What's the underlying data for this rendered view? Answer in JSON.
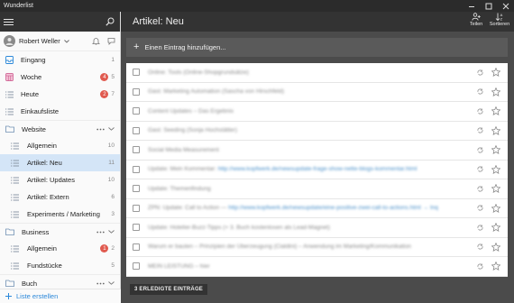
{
  "window": {
    "title": "Wunderlist"
  },
  "user": {
    "name": "Robert Weller"
  },
  "sidebar": {
    "items": [
      {
        "label": "Eingang",
        "count": "1",
        "badge": "",
        "icon": "inbox-icon",
        "indent": false,
        "active": false,
        "folder": false
      },
      {
        "label": "Woche",
        "count": "5",
        "badge": "4",
        "icon": "calendar-week-icon",
        "indent": false,
        "active": false,
        "folder": false
      },
      {
        "label": "Heute",
        "count": "7",
        "badge": "2",
        "icon": "list-icon",
        "indent": false,
        "active": false,
        "folder": false
      },
      {
        "label": "Einkaufsliste",
        "count": "",
        "badge": "",
        "icon": "list-icon",
        "indent": false,
        "active": false,
        "folder": false
      },
      {
        "label": "Website",
        "count": "",
        "badge": "",
        "icon": "folder-icon",
        "indent": false,
        "active": false,
        "folder": true
      },
      {
        "label": "Allgemein",
        "count": "10",
        "badge": "",
        "icon": "list-icon",
        "indent": true,
        "active": false,
        "folder": false
      },
      {
        "label": "Artikel: Neu",
        "count": "11",
        "badge": "",
        "icon": "list-icon",
        "indent": true,
        "active": true,
        "folder": false
      },
      {
        "label": "Artikel: Updates",
        "count": "10",
        "badge": "",
        "icon": "list-icon",
        "indent": true,
        "active": false,
        "folder": false
      },
      {
        "label": "Artikel: Extern",
        "count": "6",
        "badge": "",
        "icon": "list-icon",
        "indent": true,
        "active": false,
        "folder": false
      },
      {
        "label": "Experiments / Marketing",
        "count": "3",
        "badge": "",
        "icon": "list-icon",
        "indent": true,
        "active": false,
        "folder": false
      },
      {
        "label": "Business",
        "count": "",
        "badge": "",
        "icon": "folder-icon",
        "indent": false,
        "active": false,
        "folder": true
      },
      {
        "label": "Allgemein",
        "count": "2",
        "badge": "1",
        "icon": "list-icon",
        "indent": true,
        "active": false,
        "folder": false
      },
      {
        "label": "Fundstücke",
        "count": "5",
        "badge": "",
        "icon": "list-icon",
        "indent": true,
        "active": false,
        "folder": false
      },
      {
        "label": "Buch",
        "count": "",
        "badge": "",
        "icon": "folder-icon",
        "indent": false,
        "active": false,
        "folder": true
      }
    ],
    "new_list_label": "Liste erstellen"
  },
  "main": {
    "title": "Artikel: Neu",
    "share_label": "Teilen",
    "sort_label": "Sortieren",
    "add_placeholder": "Einen Eintrag hinzufügen...",
    "tasks": [
      {
        "text": "Online: Tools (Online-Shopgrundsätze)",
        "link": ""
      },
      {
        "text": "Gast: Marketing Automation (Sascha von Hirschfeld)",
        "link": ""
      },
      {
        "text": "Content Updates – Das Ergebnis",
        "link": ""
      },
      {
        "text": "Gast: Seeding (Sonja Hochstätter)",
        "link": ""
      },
      {
        "text": "Social Media Measurement",
        "link": ""
      },
      {
        "text": "Update: Mein Kommentar: ",
        "link": "http://www.kopfwerk.de/newsupdate-frage-show-nette-blogs-kommentar.html"
      },
      {
        "text": "Update: Themenfindung",
        "link": ""
      },
      {
        "text": "ZPN: Update: Call to Action — ",
        "link": "http://www.kopfwerk.de/newsupdate/eine-positive-zwei-call-to-actions.html → Inq"
      },
      {
        "text": "Update: Hotelier-Buzz-Tipps (+ 3. Buch kostenlosen als Lead-Magnet)",
        "link": ""
      },
      {
        "text": "Warum er bauten – Prinzipien der Überzeugung (Cialdini) – Anwendung im Marketing/Kommunikation",
        "link": ""
      },
      {
        "text": "MEIN LEISTUNG – hier",
        "link": ""
      }
    ],
    "done_button": "3 ERLEDIGTE EINTRÄGE"
  },
  "colors": {
    "accent": "#2b88d9",
    "badge": "#e05a4f",
    "active_row": "#d4e5f7",
    "header": "#333333"
  }
}
